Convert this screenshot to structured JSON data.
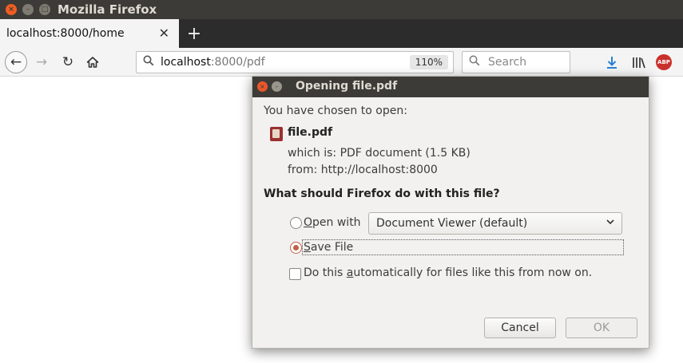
{
  "window": {
    "title": "Mozilla Firefox",
    "close_glyph": "×",
    "min_glyph": "–",
    "max_glyph": "□"
  },
  "tabs": {
    "active_label": "localhost:8000/home",
    "close_glyph": "✕",
    "new_tab_glyph": "+"
  },
  "navbar": {
    "back_glyph": "←",
    "forward_glyph": "→",
    "reload_glyph": "↻",
    "url_host": "localhost",
    "url_path": ":8000/pdf",
    "zoom": "110%",
    "search_placeholder": "Search",
    "download_glyph": "↓",
    "abp_label": "ABP"
  },
  "dialog": {
    "title": "Opening file.pdf",
    "intro": "You have chosen to open:",
    "filename": "file.pdf",
    "which_is": "which is:  PDF document (1.5 KB)",
    "from": "from:  http://localhost:8000",
    "question": "What should Firefox do with this file?",
    "open_with_accesskey": "O",
    "open_with_rest": "pen with",
    "open_with_app": "Document Viewer (default)",
    "chevron": "⌄",
    "save_accesskey": "S",
    "save_rest": "ave File",
    "auto_pre": "Do this ",
    "auto_accesskey": "a",
    "auto_post": "utomatically for files like this from now on.",
    "cancel_label": "Cancel",
    "ok_label": "OK",
    "selected_action": "Save File",
    "auto_checked": false
  },
  "icons": [
    "close-window-icon",
    "back-arrow-icon",
    "forward-arrow-icon",
    "reload-icon",
    "home-icon",
    "search-icon",
    "download-icon",
    "library-icon",
    "adblock-plus-icon",
    "pdf-file-icon"
  ],
  "colors": {
    "titlebar": "#3c3b37",
    "close_button": "#f05d23",
    "radio_accent": "#c1614a",
    "download_icon": "#2a7fd4",
    "abp": "#c9302c"
  }
}
